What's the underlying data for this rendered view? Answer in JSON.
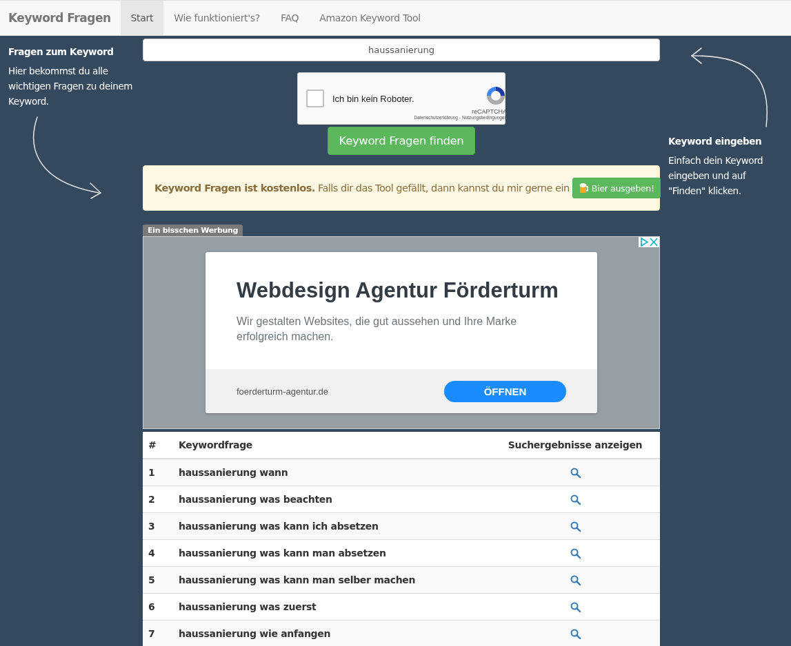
{
  "navbar": {
    "brand": "Keyword Fragen",
    "tabs": [
      {
        "label": "Start",
        "selected": true
      },
      {
        "label": "Wie funktioniert's?",
        "selected": false
      },
      {
        "label": "FAQ",
        "selected": false
      },
      {
        "label": "Amazon Keyword Tool",
        "selected": false
      }
    ]
  },
  "left_help": {
    "title": "Fragen zum Keyword",
    "text": "Hier bekommst du alle wichtigen Fragen zu deinem Keyword."
  },
  "right_help": {
    "title": "Keyword eingeben",
    "text": "Einfach dein Keyword eingeben und auf \"Finden\" klicken."
  },
  "search": {
    "value": "haussanierung"
  },
  "captcha": {
    "label": "Ich bin kein Roboter.",
    "checked": false,
    "brand": "reCAPTCHA",
    "privacy": "Datenschutzerklärung",
    "separator": "-",
    "terms": "Nutzungsbedingungen"
  },
  "submit_button": "Keyword Fragen finden",
  "notice": {
    "text": "**Keyword Fragen ist kostenlos.** Falls dir das Tool gefällt, dann kannst du mir gerne ein",
    "button": "Bier ausgeben!"
  },
  "ad": {
    "label": "Ein bisschen Werbung",
    "title": "Webdesign Agentur Förderturm",
    "description": "Wir gestalten Websites, die gut aussehen und Ihre Marke erfolgreich machen.",
    "url": "foerderturm-agentur.de",
    "button": "ÖFFNEN"
  },
  "table": {
    "columns": [
      "#",
      "Keywordfrage",
      "Suchergebnisse anzeigen"
    ],
    "rows": [
      {
        "index": "1",
        "question": "haussanierung wann"
      },
      {
        "index": "2",
        "question": "haussanierung was beachten"
      },
      {
        "index": "3",
        "question": "haussanierung was kann ich absetzen"
      },
      {
        "index": "4",
        "question": "haussanierung was kann man absetzen"
      },
      {
        "index": "5",
        "question": "haussanierung was kann man selber machen"
      },
      {
        "index": "6",
        "question": "haussanierung was zuerst"
      },
      {
        "index": "7",
        "question": "haussanierung wie anfangen"
      }
    ]
  }
}
